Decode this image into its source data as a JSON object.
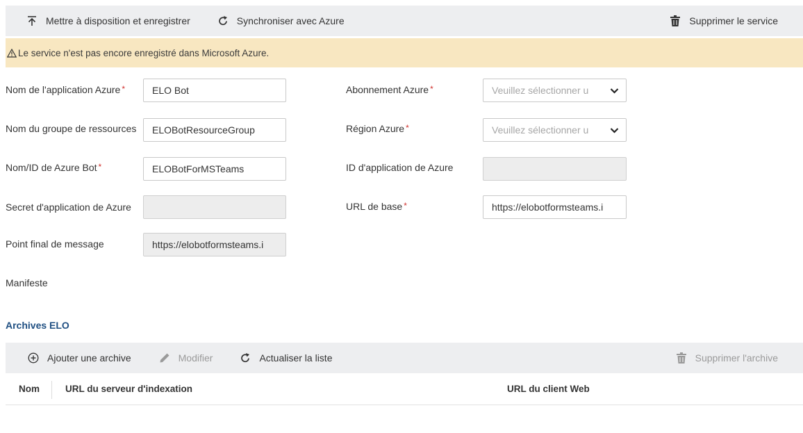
{
  "toolbar": {
    "publish_label": "Mettre à disposition et enregistrer",
    "sync_label": "Synchroniser avec Azure",
    "delete_label": "Supprimer le service"
  },
  "warning": {
    "text": "Le service n'est pas encore enregistré dans Microsoft Azure."
  },
  "form": {
    "app_name": {
      "label": "Nom de l'application Azure",
      "value": "ELO Bot",
      "required": "*"
    },
    "resource_group": {
      "label": "Nom du groupe de ressources",
      "value": "ELOBotResourceGroup"
    },
    "bot_id": {
      "label": "Nom/ID de Azure Bot",
      "value": "ELOBotForMSTeams",
      "required": "*"
    },
    "app_secret": {
      "label": "Secret d'application de Azure",
      "value": ""
    },
    "message_endpoint": {
      "label": "Point final de message",
      "value": "https://elobotformsteams.i"
    },
    "manifest": {
      "label": "Manifeste"
    },
    "subscription": {
      "label": "Abonnement Azure",
      "placeholder": "Veuillez sélectionner u",
      "required": "*"
    },
    "region": {
      "label": "Région Azure",
      "placeholder": "Veuillez sélectionner u",
      "required": "*"
    },
    "app_id": {
      "label": "ID d'application de Azure",
      "value": ""
    },
    "base_url": {
      "label": "URL de base",
      "value": "https://elobotformsteams.i",
      "required": "*"
    }
  },
  "archives": {
    "title": "Archives ELO",
    "toolbar": {
      "add_label": "Ajouter une archive",
      "edit_label": "Modifier",
      "refresh_label": "Actualiser la liste",
      "delete_label": "Supprimer l'archive"
    },
    "columns": [
      "Nom",
      "URL du serveur d'indexation",
      "URL du client Web"
    ]
  },
  "colors": {
    "toolbar_bg": "#edeef0",
    "warning_bg": "#f8e7c1",
    "required": "#d0312d",
    "section_title": "#1f4f82"
  }
}
